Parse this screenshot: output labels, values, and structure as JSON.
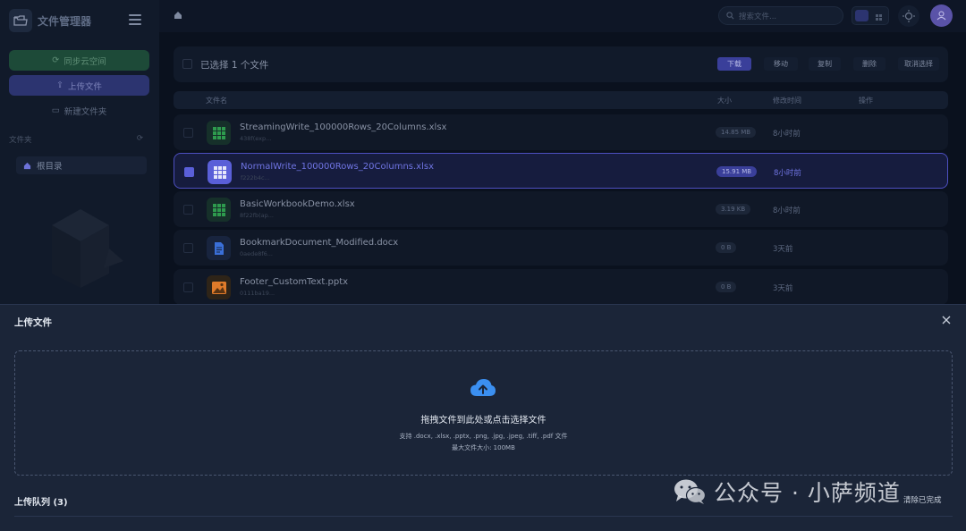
{
  "app": {
    "title": "文件管理器"
  },
  "sidebar": {
    "sync_label": "同步云空间",
    "upload_label": "上传文件",
    "new_folder_label": "新建文件夹",
    "section_label": "文件夹",
    "root_label": "根目录"
  },
  "topbar": {
    "search_placeholder": "搜索文件..."
  },
  "action_bar": {
    "selected_text": "已选择 1 个文件",
    "download": "下载",
    "move": "移动",
    "copy": "复制",
    "delete": "删除",
    "cancel": "取消选择"
  },
  "table": {
    "headers": {
      "name": "文件名",
      "size": "大小",
      "modified": "修改时间",
      "actions": "操作"
    },
    "rows": [
      {
        "name": "StreamingWrite_100000Rows_20Columns.xlsx",
        "sub": "438f(exp...",
        "size": "14.85 MB",
        "time": "8小时前",
        "type": "xlsx",
        "selected": false
      },
      {
        "name": "NormalWrite_100000Rows_20Columns.xlsx",
        "sub": "f222b4c...",
        "size": "15.91 MB",
        "time": "8小时前",
        "type": "xlsx",
        "selected": true
      },
      {
        "name": "BasicWorkbookDemo.xlsx",
        "sub": "8f22fb(ap...",
        "size": "3.19 KB",
        "time": "8小时前",
        "type": "xlsx",
        "selected": false
      },
      {
        "name": "BookmarkDocument_Modified.docx",
        "sub": "0aede8f6...",
        "size": "0 B",
        "time": "3天前",
        "type": "docx",
        "selected": false
      },
      {
        "name": "Footer_CustomText.pptx",
        "sub": "0111ba19...",
        "size": "0 B",
        "time": "3天前",
        "type": "pptx",
        "selected": false
      }
    ]
  },
  "upload_panel": {
    "title": "上传文件",
    "drop_text": "拖拽文件到此处或点击选择文件",
    "supported": "支持 .docx, .xlsx, .pptx, .png, .jpg, .jpeg, .tiff, .pdf 文件",
    "max_size": "最大文件大小: 100MB",
    "queue_title": "上传队列 (3)",
    "clear_done": "清除已完成"
  },
  "watermark": {
    "text": "公众号 · 小萨频道"
  },
  "colors": {
    "accent": "#5a5fd8",
    "upload_icon": "#3b8ff0",
    "excel_green": "#2e9b4e",
    "word_blue": "#3a6fd8",
    "ppt_orange": "#e07b2a"
  },
  "icons": [
    "folder-open-icon",
    "menu-icon",
    "sync-icon",
    "upload-icon",
    "folder-plus-icon",
    "refresh-icon",
    "home-icon",
    "search-icon",
    "list-view-icon",
    "grid-view-icon",
    "sun-icon",
    "user-icon",
    "cloud-upload-icon",
    "close-icon",
    "wechat-icon"
  ]
}
